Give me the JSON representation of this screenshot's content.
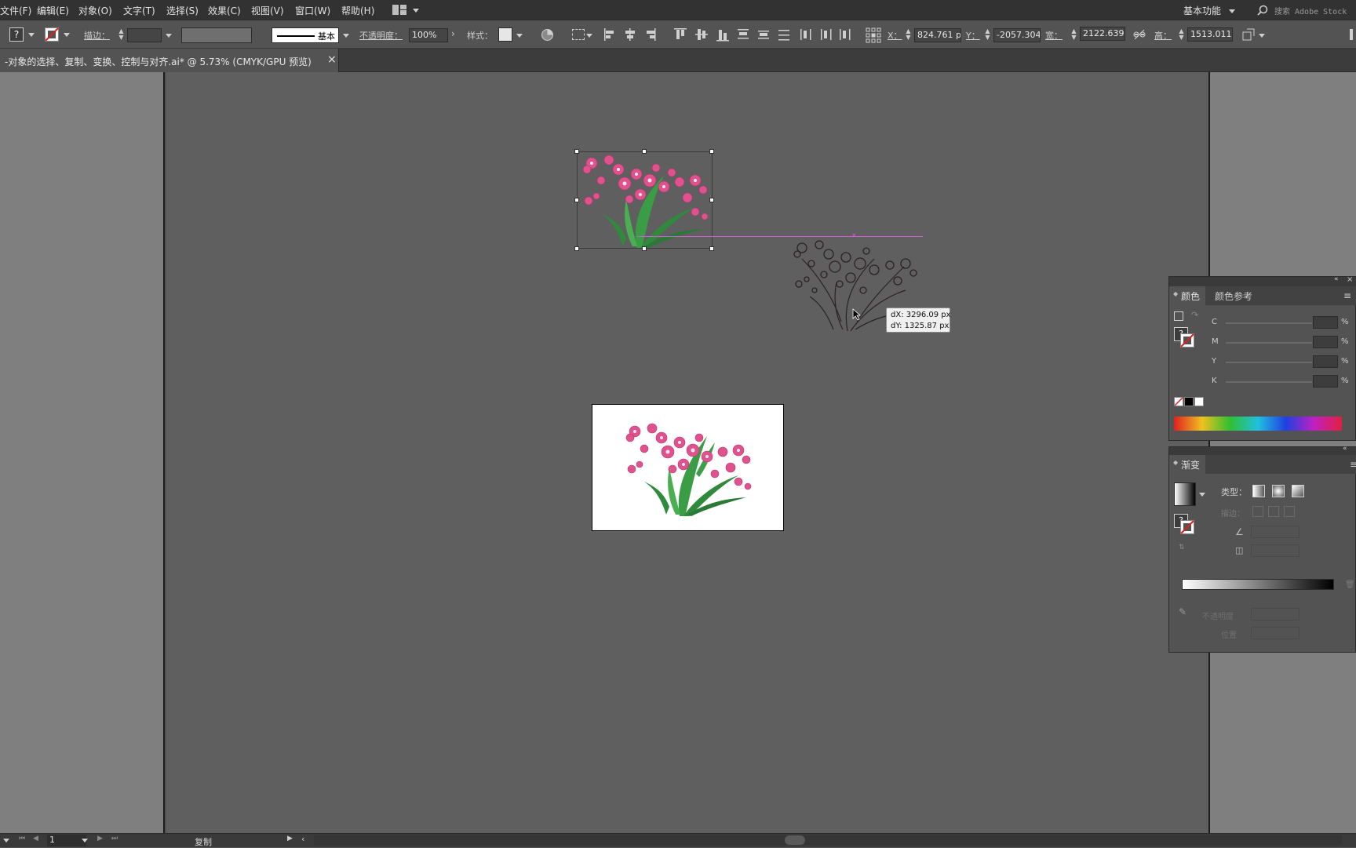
{
  "menubar": {
    "items": [
      "文件(F)",
      "编辑(E)",
      "对象(O)",
      "文字(T)",
      "选择(S)",
      "效果(C)",
      "视图(V)",
      "窗口(W)",
      "帮助(H)"
    ],
    "workspace": "基本功能",
    "search_placeholder": "搜索 Adobe Stock"
  },
  "control_bar": {
    "stroke_label": "描边：",
    "stroke_style": "基本",
    "opacity_label": "不透明度：",
    "opacity_value": "100%",
    "style_label": "样式：",
    "x_label": "X：",
    "x_value": "824.761 p",
    "y_label": "Y：",
    "y_value": "-2057.304",
    "w_label": "宽：",
    "w_value": "2122.639",
    "h_label": "高：",
    "h_value": "1513.011"
  },
  "document_tab": {
    "title": "-对象的选择、复制、变换、控制与对齐.ai* @ 5.73% (CMYK/GPU 预览)",
    "close": "×"
  },
  "tooltip": {
    "dx": "dX: 3296.09 px",
    "dy": "dY: 1325.87 px"
  },
  "color_panel": {
    "tabs": [
      "颜色",
      "颜色参考"
    ],
    "channels": [
      "C",
      "M",
      "Y",
      "K"
    ],
    "unit": "%"
  },
  "gradient_panel": {
    "tab": "渐变",
    "type_label": "类型：",
    "stroke_label": "描边：",
    "opacity_label": "不透明度",
    "position_label": "位置"
  },
  "statusbar": {
    "page": "1",
    "action": "复制"
  },
  "colors": {
    "accent_pink": "#e0528e",
    "leaf_green": "#2f8a3c",
    "silhouette": "#2a2227",
    "smart_guide": "#d35bd3"
  }
}
